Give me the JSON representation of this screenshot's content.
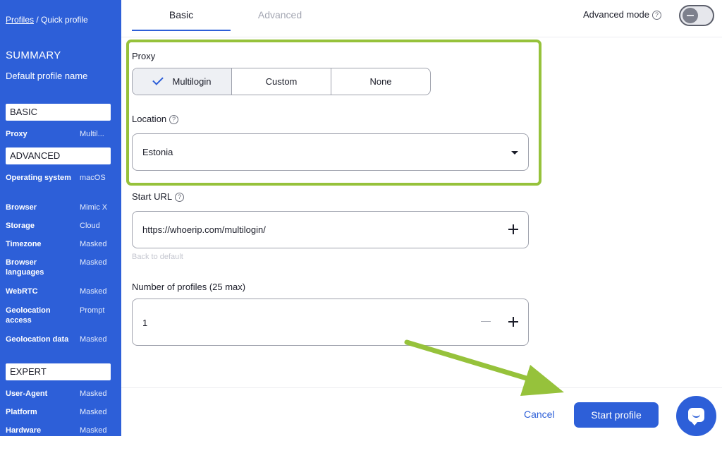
{
  "breadcrumb": {
    "profiles": "Profiles",
    "separator": " / ",
    "current": "Quick profile"
  },
  "summary": {
    "title": "SUMMARY",
    "profile_name": "Default profile name"
  },
  "sections": {
    "basic": "BASIC",
    "advanced": "ADVANCED",
    "expert": "EXPERT"
  },
  "basic_rows": [
    {
      "key": "Proxy",
      "value": "Multil..."
    }
  ],
  "advanced_rows": [
    {
      "key": "Operating system",
      "value": "macOS"
    },
    {
      "key": "Browser",
      "value": "Mimic X"
    },
    {
      "key": "Storage",
      "value": "Cloud"
    },
    {
      "key": "Timezone",
      "value": "Masked"
    },
    {
      "key": "Browser languages",
      "value": "Masked"
    },
    {
      "key": "WebRTC",
      "value": "Masked"
    },
    {
      "key": "Geolocation access",
      "value": "Prompt"
    },
    {
      "key": "Geolocation data",
      "value": "Masked"
    }
  ],
  "expert_rows": [
    {
      "key": "User-Agent",
      "value": "Masked"
    },
    {
      "key": "Platform",
      "value": "Masked"
    },
    {
      "key": "Hardware",
      "value": "Masked"
    }
  ],
  "tabs": {
    "basic": "Basic",
    "advanced": "Advanced"
  },
  "advanced_mode": {
    "label": "Advanced mode",
    "help": "?",
    "enabled": false
  },
  "proxy": {
    "label": "Proxy",
    "options": [
      "Multilogin",
      "Custom",
      "None"
    ],
    "selected": "Multilogin"
  },
  "location": {
    "label": "Location",
    "help": "?",
    "value": "Estonia"
  },
  "start_url": {
    "label": "Start URL",
    "help": "?",
    "value": "https://whoerip.com/multilogin/",
    "back_to_default": "Back to default"
  },
  "profiles_count": {
    "label": "Number of profiles (25 max)",
    "value": "1"
  },
  "footer": {
    "cancel": "Cancel",
    "start": "Start profile"
  },
  "colors": {
    "accent": "#2d5fd8",
    "highlight": "#96c23b"
  },
  "icons": {
    "check": "check-icon",
    "caret": "caret-down-icon",
    "plus": "plus-icon",
    "minus": "minus-icon",
    "chat": "chat-icon",
    "help": "help-circle-icon"
  }
}
